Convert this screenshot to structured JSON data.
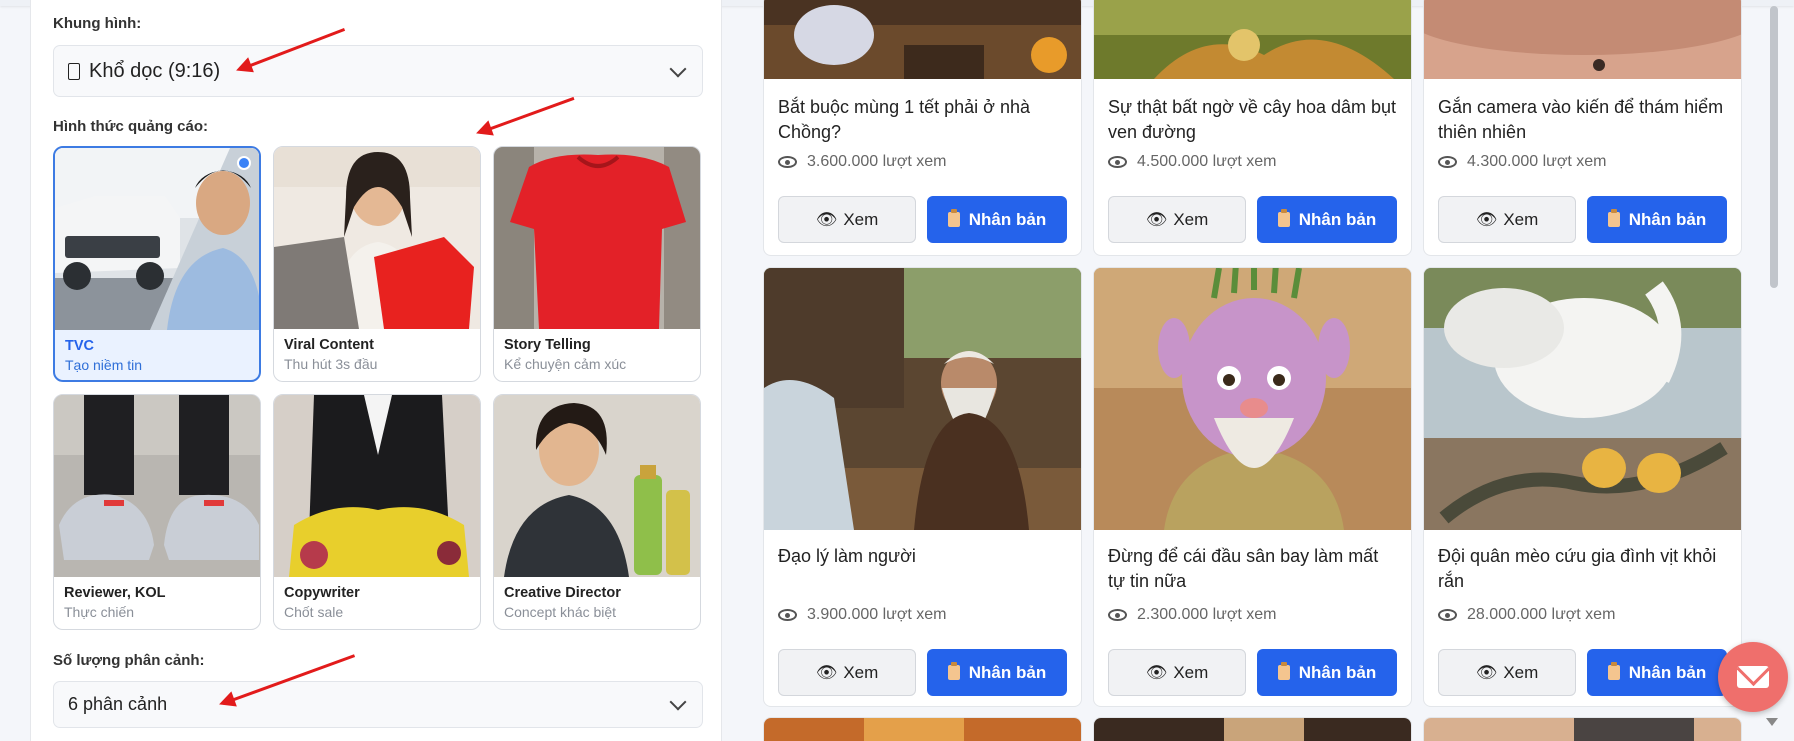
{
  "form": {
    "frame_label": "Khung hình:",
    "frame_value": "Khổ dọc (9:16)",
    "ad_type_label": "Hình thức quảng cáo:",
    "ad_types": [
      {
        "title": "TVC",
        "subtitle": "Tạo niềm tin",
        "selected": true
      },
      {
        "title": "Viral Content",
        "subtitle": "Thu hút 3s đầu",
        "selected": false
      },
      {
        "title": "Story Telling",
        "subtitle": "Kể chuyện cảm xúc",
        "selected": false
      },
      {
        "title": "Reviewer, KOL",
        "subtitle": "Thực chiến",
        "selected": false
      },
      {
        "title": "Copywriter",
        "subtitle": "Chốt sale",
        "selected": false
      },
      {
        "title": "Creative Director",
        "subtitle": "Concept khác biệt",
        "selected": false
      }
    ],
    "scene_label": "Số lượng phân cảnh:",
    "scene_value": "6 phân cảnh"
  },
  "videos": [
    {
      "title": "Bắt buộc mùng 1 tết phải ở nhà Chồng?",
      "views": "3.600.000 lượt xem"
    },
    {
      "title": "Sự thật bất ngờ về cây hoa dâm bụt ven đường",
      "views": "4.500.000 lượt xem"
    },
    {
      "title": "Gắn camera vào kiến để thám hiểm thiên nhiên",
      "views": "4.300.000 lượt xem"
    },
    {
      "title": "Đạo lý làm người",
      "views": "3.900.000 lượt xem"
    },
    {
      "title": "Đừng để cái đầu sân bay làm mất tự tin nữa",
      "views": "2.300.000 lượt xem"
    },
    {
      "title": "Đội quân mèo cứu gia đình vịt khỏi rắn",
      "views": "28.000.000 lượt xem"
    }
  ],
  "buttons": {
    "view": "Xem",
    "copy": "Nhân bản"
  },
  "colors": {
    "accent": "#2563eb",
    "annotation": "#e21b1b",
    "mail": "#ef6f6c"
  }
}
